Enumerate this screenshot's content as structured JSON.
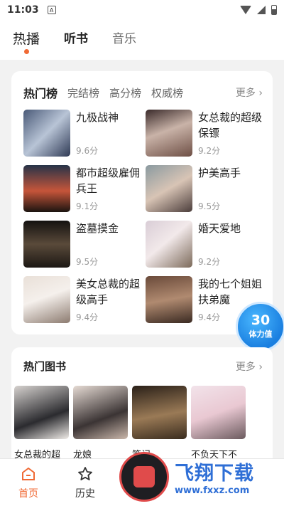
{
  "status_bar": {
    "time": "11:03",
    "sim_glyph": "A"
  },
  "top_tabs": [
    {
      "label": "热播"
    },
    {
      "label": "听书"
    },
    {
      "label": "音乐"
    }
  ],
  "ranking": {
    "tabs": [
      "热门榜",
      "完结榜",
      "高分榜",
      "权威榜"
    ],
    "more": "更多",
    "books": [
      {
        "title": "九极战神",
        "score": "9.6分"
      },
      {
        "title": "女总裁的超级保镖",
        "score": "9.2分"
      },
      {
        "title": "都市超级雇佣兵王",
        "score": "9.1分"
      },
      {
        "title": "护美高手",
        "score": "9.5分"
      },
      {
        "title": "盗墓摸金",
        "score": "9.5分"
      },
      {
        "title": "婚天爱地",
        "score": "9.2分"
      },
      {
        "title": "美女总裁的超级高手",
        "score": "9.4分"
      },
      {
        "title": "我的七个姐姐扶弟魔",
        "score": "9.4分"
      }
    ]
  },
  "stamina": {
    "value": "30",
    "label": "体力值"
  },
  "hot_books": {
    "title": "热门图书",
    "more": "更多",
    "names": [
      "女总裁的超",
      "龙娘",
      "笔记",
      "不负天下不"
    ]
  },
  "bottom_nav": [
    {
      "label": "首页"
    },
    {
      "label": "历史"
    },
    {
      "label": ""
    },
    {
      "label": ""
    },
    {
      "label": ""
    }
  ],
  "watermark": {
    "title": "飞翔下载",
    "url": "www.fxxz.com"
  },
  "colors": {
    "accent": "#f06a35",
    "stamina": "#1a7fe0",
    "watermark": "#2f6fd6"
  }
}
